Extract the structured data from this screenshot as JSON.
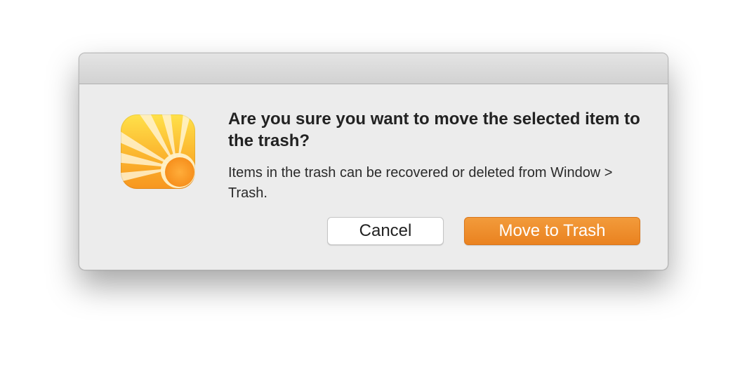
{
  "dialog": {
    "app_icon": "sunrise-app-icon",
    "heading": "Are you sure you want to move the selected item to the trash?",
    "message": "Items in the trash can be recovered or deleted from Window > Trash.",
    "buttons": {
      "cancel_label": "Cancel",
      "confirm_label": "Move to Trash"
    }
  },
  "colors": {
    "accent": "#ED8A2A",
    "dialog_background": "#ECECEC",
    "icon_yellow": "#FFD53A",
    "icon_orange": "#F7931E"
  }
}
